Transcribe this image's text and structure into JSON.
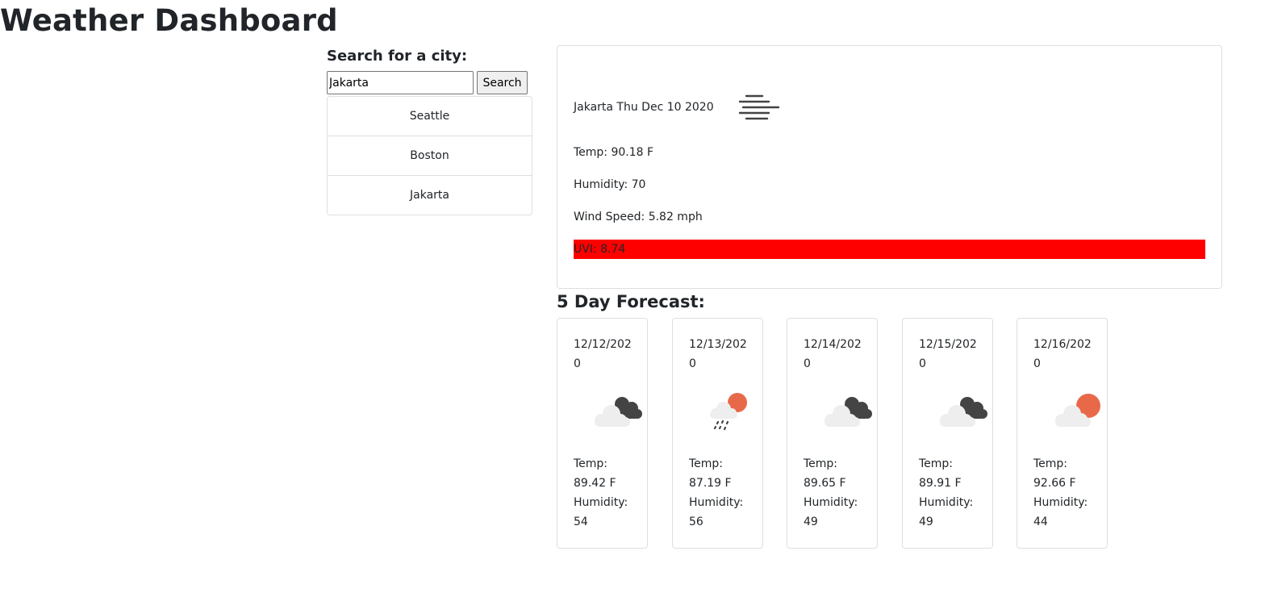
{
  "app": {
    "title": "Weather Dashboard"
  },
  "search": {
    "label": "Search for a city:",
    "value": "Jakarta",
    "placeholder": "",
    "button_label": "Search"
  },
  "history": [
    {
      "label": "Seattle"
    },
    {
      "label": "Boston"
    },
    {
      "label": "Jakarta"
    }
  ],
  "current": {
    "heading": "Jakarta Thu Dec 10 2020",
    "icon": "mist-icon",
    "temp": "Temp: 90.18 F",
    "humidity": "Humidity: 70",
    "wind": "Wind Speed: 5.82 mph",
    "uvi": "UVI: 8.74",
    "uvi_color": "#ff0000"
  },
  "forecast": {
    "title": "5 Day Forecast:",
    "days": [
      {
        "date": "12/12/2020",
        "icon": "broken-clouds-icon",
        "temp_label": "Temp:",
        "temp": "89.42 F",
        "humidity_label": "Humidity:",
        "humidity": "54"
      },
      {
        "date": "12/13/2020",
        "icon": "rain-icon",
        "temp_label": "Temp:",
        "temp": "87.19 F",
        "humidity_label": "Humidity:",
        "humidity": "56"
      },
      {
        "date": "12/14/2020",
        "icon": "broken-clouds-icon",
        "temp_label": "Temp:",
        "temp": "89.65 F",
        "humidity_label": "Humidity:",
        "humidity": "49"
      },
      {
        "date": "12/15/2020",
        "icon": "broken-clouds-icon",
        "temp_label": "Temp:",
        "temp": "89.91 F",
        "humidity_label": "Humidity:",
        "humidity": "49"
      },
      {
        "date": "12/16/2020",
        "icon": "few-clouds-icon",
        "temp_label": "Temp:",
        "temp": "92.66 F",
        "humidity_label": "Humidity:",
        "humidity": "44"
      }
    ]
  },
  "colors": {
    "sun": "#e8694a",
    "dark_cloud": "#444444",
    "light_cloud": "#eeeeee"
  }
}
